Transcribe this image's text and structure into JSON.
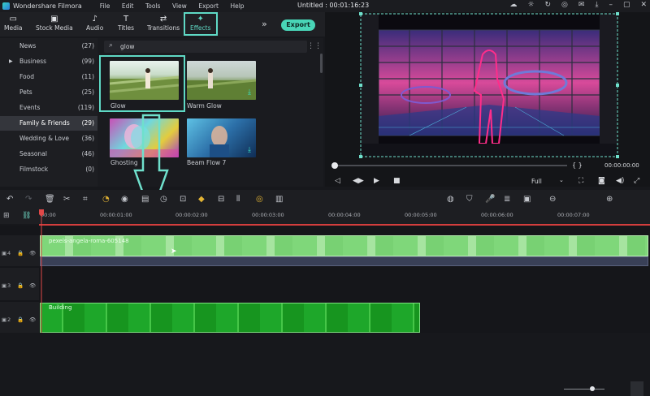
{
  "app": {
    "name": "Wondershare Filmora",
    "menu": [
      "File",
      "Edit",
      "Tools",
      "View",
      "Export",
      "Help"
    ],
    "project_title": "Untitled : 00:01:16:23"
  },
  "toolbar": {
    "tabs": [
      {
        "label": "Media",
        "icon": "folder-icon"
      },
      {
        "label": "Stock Media",
        "icon": "stock-media-icon"
      },
      {
        "label": "Audio",
        "icon": "music-note-icon"
      },
      {
        "label": "Titles",
        "icon": "title-T-icon"
      },
      {
        "label": "Transitions",
        "icon": "transitions-icon"
      },
      {
        "label": "Effects",
        "icon": "effects-wand-icon",
        "selected": true
      }
    ],
    "export_label": "Export",
    "accent_color": "#49d5b7"
  },
  "sidebar": {
    "items": [
      {
        "label": "News",
        "count": "(27)"
      },
      {
        "label": "Business",
        "count": "(99)",
        "expandable": true
      },
      {
        "label": "Food",
        "count": "(11)"
      },
      {
        "label": "Pets",
        "count": "(25)"
      },
      {
        "label": "Events",
        "count": "(119)"
      },
      {
        "label": "Family & Friends",
        "count": "(29)",
        "selected": true
      },
      {
        "label": "Wedding & Love",
        "count": "(36)"
      },
      {
        "label": "Seasonal",
        "count": "(46)"
      },
      {
        "label": "Filmstock",
        "count": "(0)"
      }
    ]
  },
  "search": {
    "value": "glow"
  },
  "effects": [
    {
      "label": "Glow",
      "selected": true
    },
    {
      "label": "Warm Glow",
      "download": true
    },
    {
      "label": "Ghosting"
    },
    {
      "label": "Beam Flow 7",
      "download": true
    }
  ],
  "preview": {
    "timecode": "00:00:00:00",
    "quality": "Full",
    "brackets": "{ }"
  },
  "timeline": {
    "ruler": [
      "00:00",
      "00:00:01:00",
      "00:00:02:00",
      "00:00:03:00",
      "00:00:04:00",
      "00:00:05:00",
      "00:00:06:00",
      "00:00:07:00"
    ],
    "tracks": [
      {
        "number": "4",
        "clip_title": "pexels-angela-roma-605148",
        "color": "#8fdc89"
      },
      {
        "number": "3"
      },
      {
        "number": "2",
        "clip_title": "Building",
        "color": "#1ea72a"
      }
    ]
  }
}
